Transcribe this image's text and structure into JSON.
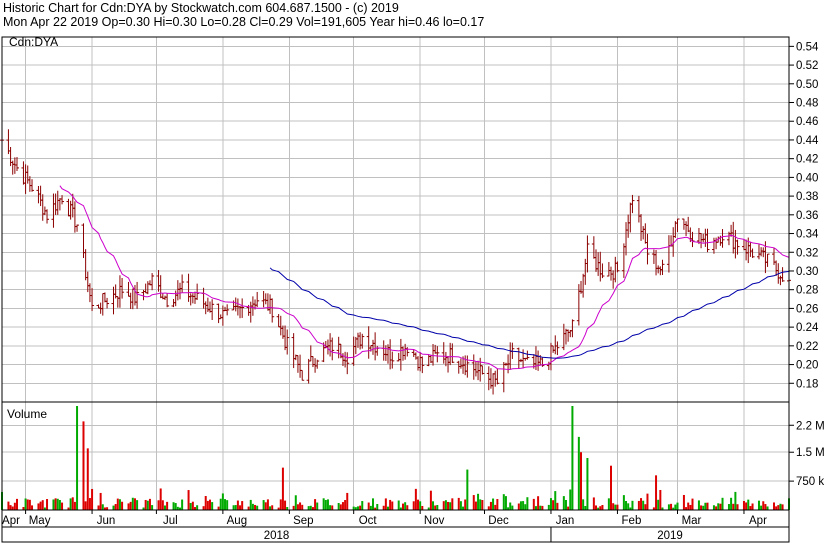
{
  "header": {
    "line1": "Historic Chart for Cdn:DYA by Stockwatch.com 604.687.1500 - (c) 2019",
    "line2": "Mon Apr 22 2019  Op=0.30  Hi=0.30  Lo=0.28  Cl=0.29  Vol=191,605  Year hi=0.46  lo=0.17"
  },
  "colors": {
    "price_bar": "#8b0000",
    "ma_short": "#cc00cc",
    "ma_long": "#0000aa",
    "vol_up": "#00aa00",
    "vol_down": "#dd0000",
    "grid": "#c0c0c0",
    "axis": "#000000"
  },
  "chart_data": [
    {
      "type": "bar",
      "title": "Cdn:DYA",
      "subtype": "ohlc",
      "ylim": [
        0.16,
        0.55
      ],
      "y_ticks": [
        "0.54",
        "0.52",
        "0.50",
        "0.48",
        "0.46",
        "0.44",
        "0.42",
        "0.40",
        "0.38",
        "0.36",
        "0.34",
        "0.32",
        "0.30",
        "0.28",
        "0.26",
        "0.24",
        "0.22",
        "0.20",
        "0.18"
      ],
      "x_months": [
        "Apr",
        "May",
        "Jun",
        "Jul",
        "Aug",
        "Sep",
        "Oct",
        "Nov",
        "Dec",
        "Jan",
        "Feb",
        "Mar",
        "Apr"
      ],
      "x_years": [
        "2018",
        "2019"
      ],
      "date_range": [
        "2018-04-20",
        "2019-04-22"
      ],
      "close_series": [
        [
          "2018-04-20",
          0.44
        ],
        [
          "2018-04-27",
          0.41
        ],
        [
          "2018-05-04",
          0.39
        ],
        [
          "2018-05-11",
          0.36
        ],
        [
          "2018-05-18",
          0.38
        ],
        [
          "2018-05-25",
          0.35
        ],
        [
          "2018-06-01",
          0.26
        ],
        [
          "2018-06-08",
          0.27
        ],
        [
          "2018-06-15",
          0.28
        ],
        [
          "2018-06-22",
          0.27
        ],
        [
          "2018-06-29",
          0.29
        ],
        [
          "2018-07-06",
          0.27
        ],
        [
          "2018-07-13",
          0.28
        ],
        [
          "2018-07-20",
          0.27
        ],
        [
          "2018-07-27",
          0.26
        ],
        [
          "2018-08-03",
          0.25
        ],
        [
          "2018-08-10",
          0.26
        ],
        [
          "2018-08-17",
          0.27
        ],
        [
          "2018-08-24",
          0.26
        ],
        [
          "2018-08-31",
          0.22
        ],
        [
          "2018-09-07",
          0.19
        ],
        [
          "2018-09-14",
          0.21
        ],
        [
          "2018-09-21",
          0.22
        ],
        [
          "2018-09-28",
          0.21
        ],
        [
          "2018-10-05",
          0.23
        ],
        [
          "2018-10-12",
          0.22
        ],
        [
          "2018-10-19",
          0.21
        ],
        [
          "2018-10-26",
          0.22
        ],
        [
          "2018-11-02",
          0.2
        ],
        [
          "2018-11-09",
          0.21
        ],
        [
          "2018-11-16",
          0.21
        ],
        [
          "2018-11-23",
          0.2
        ],
        [
          "2018-11-30",
          0.19
        ],
        [
          "2018-12-07",
          0.18
        ],
        [
          "2018-12-14",
          0.21
        ],
        [
          "2018-12-21",
          0.2
        ],
        [
          "2018-12-28",
          0.2
        ],
        [
          "2019-01-04",
          0.22
        ],
        [
          "2019-01-11",
          0.24
        ],
        [
          "2019-01-18",
          0.32
        ],
        [
          "2019-01-25",
          0.3
        ],
        [
          "2019-02-01",
          0.3
        ],
        [
          "2019-02-08",
          0.38
        ],
        [
          "2019-02-15",
          0.32
        ],
        [
          "2019-02-22",
          0.3
        ],
        [
          "2019-03-01",
          0.36
        ],
        [
          "2019-03-08",
          0.34
        ],
        [
          "2019-03-15",
          0.33
        ],
        [
          "2019-03-22",
          0.34
        ],
        [
          "2019-03-29",
          0.33
        ],
        [
          "2019-04-05",
          0.32
        ],
        [
          "2019-04-12",
          0.31
        ],
        [
          "2019-04-22",
          0.29
        ]
      ],
      "year_hi": 0.46,
      "year_lo": 0.17
    },
    {
      "type": "bar",
      "title": "Volume",
      "y_ticks": [
        "2.2 M",
        "1.5 M",
        "750 k"
      ],
      "ylim": [
        0,
        2700000
      ],
      "highlights": [
        [
          "2018-05-25",
          2700000
        ],
        [
          "2018-05-28",
          2300000
        ],
        [
          "2018-05-30",
          1600000
        ],
        [
          "2018-08-29",
          1100000
        ],
        [
          "2018-11-23",
          1050000
        ],
        [
          "2019-01-11",
          2700000
        ],
        [
          "2019-01-14",
          1900000
        ],
        [
          "2019-01-15",
          1500000
        ],
        [
          "2019-01-18",
          1350000
        ],
        [
          "2019-01-29",
          1150000
        ],
        [
          "2019-02-19",
          900000
        ]
      ]
    }
  ]
}
